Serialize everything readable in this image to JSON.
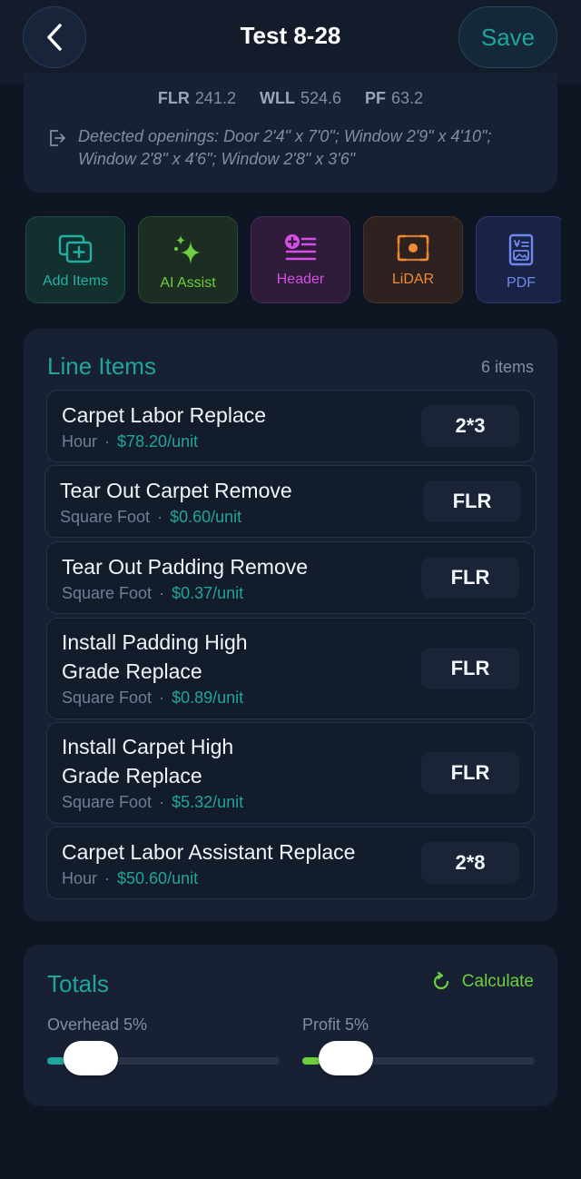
{
  "header": {
    "title": "Test 8-28",
    "save_label": "Save"
  },
  "measurements": {
    "flr_label": "FLR",
    "flr_value": "241.2",
    "wll_label": "WLL",
    "wll_value": "524.6",
    "pf_label": "PF",
    "pf_value": "63.2",
    "openings_text": "Detected openings: Door 2'4\" x 7'0\"; Window 2'9\" x 4'10\"; Window 2'8\" x 4'6\"; Window 2'8\" x 3'6\""
  },
  "actions": [
    {
      "label": "Add Items",
      "icon": "add-items-icon"
    },
    {
      "label": "AI Assist",
      "icon": "sparkles-icon"
    },
    {
      "label": "Header",
      "icon": "header-list-icon"
    },
    {
      "label": "LiDAR",
      "icon": "lidar-scan-icon"
    },
    {
      "label": "PDF",
      "icon": "pdf-document-icon"
    }
  ],
  "line_items": {
    "title": "Line Items",
    "count": "6 items",
    "unit_suffix": "/unit",
    "items": [
      {
        "name_line1": "Carpet Labor Replace",
        "name_line2": "",
        "unit": "Hour",
        "price": "$78.20",
        "qty": "2*3"
      },
      {
        "name_line1": "Tear Out Carpet Remove",
        "name_line2": "",
        "unit": "Square Foot",
        "price": "$0.60",
        "qty": "FLR"
      },
      {
        "name_line1": "Tear Out Padding Remove",
        "name_line2": "",
        "unit": "Square Foot",
        "price": "$0.37",
        "qty": "FLR"
      },
      {
        "name_line1": "Install Padding High",
        "name_line2": "Grade Replace",
        "unit": "Square Foot",
        "price": "$0.89",
        "qty": "FLR"
      },
      {
        "name_line1": "Install Carpet High",
        "name_line2": "Grade Replace",
        "unit": "Square Foot",
        "price": "$5.32",
        "qty": "FLR"
      },
      {
        "name_line1": "Carpet Labor Assistant Replace",
        "name_line2": "",
        "unit": "Hour",
        "price": "$50.60",
        "qty": "2*8"
      }
    ]
  },
  "totals": {
    "title": "Totals",
    "calculate_label": "Calculate",
    "overhead_label": "Overhead 5%",
    "profit_label": "Profit 5%",
    "overhead_percent": 5,
    "profit_percent": 5
  },
  "colors": {
    "accent_teal": "#1fa59c",
    "accent_green": "#6ccf3e",
    "accent_magenta": "#d64ee6",
    "accent_orange": "#f08a34",
    "accent_blue": "#6e88ee"
  }
}
